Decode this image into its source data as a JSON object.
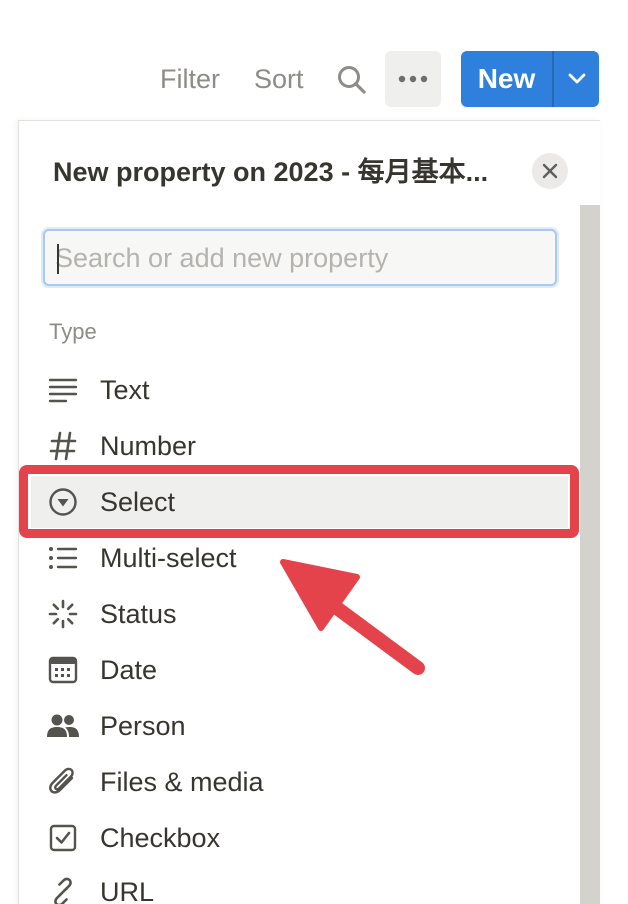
{
  "toolbar": {
    "filter_label": "Filter",
    "sort_label": "Sort",
    "search_icon": "search-icon",
    "more_icon": "more-horizontal-icon",
    "new_label": "New",
    "new_chevron_icon": "chevron-down-icon"
  },
  "panel": {
    "title": "New property on 2023 - 每月基本...",
    "close_icon": "close-icon",
    "search": {
      "placeholder": "Search or add new property",
      "value": ""
    },
    "section_label": "Type",
    "items": [
      {
        "label": "Text",
        "icon": "text-lines-icon",
        "selected": false
      },
      {
        "label": "Number",
        "icon": "hash-icon",
        "selected": false
      },
      {
        "label": "Select",
        "icon": "select-circle-icon",
        "selected": true
      },
      {
        "label": "Multi-select",
        "icon": "list-icon",
        "selected": false
      },
      {
        "label": "Status",
        "icon": "status-spinner-icon",
        "selected": false
      },
      {
        "label": "Date",
        "icon": "calendar-icon",
        "selected": false
      },
      {
        "label": "Person",
        "icon": "people-icon",
        "selected": false
      },
      {
        "label": "Files & media",
        "icon": "paperclip-icon",
        "selected": false
      },
      {
        "label": "Checkbox",
        "icon": "checkbox-icon",
        "selected": false
      },
      {
        "label": "URL",
        "icon": "link-icon",
        "selected": false
      }
    ]
  },
  "colors": {
    "accent_blue": "#2f80dd",
    "annotation_red": "#e4434c",
    "text_primary": "#37352f",
    "text_muted": "#8e8c88"
  }
}
